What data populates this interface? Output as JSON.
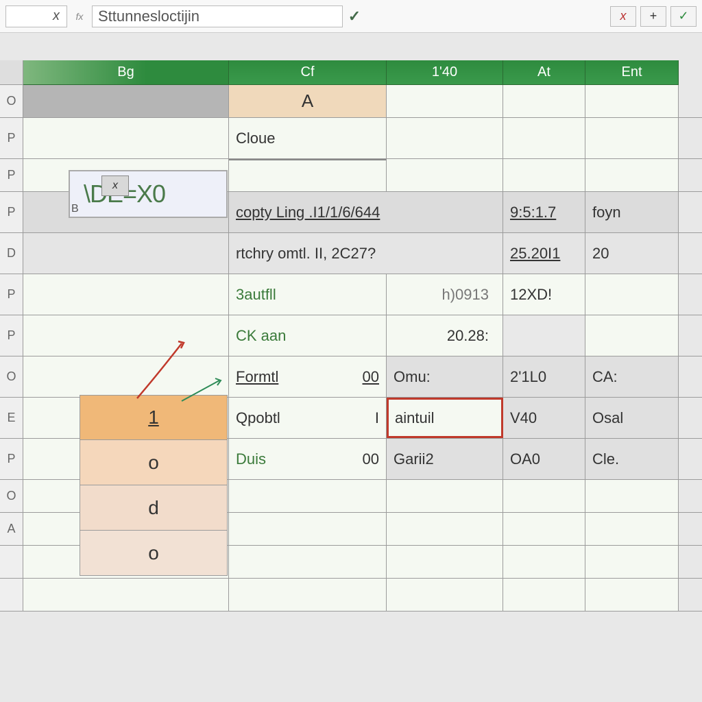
{
  "formula_bar": {
    "name_box": "x",
    "fx_label": "fx",
    "input_text": "Sttunnesloctijin",
    "controls": {
      "check1": "✓",
      "x": "x",
      "plus": "+",
      "check2": "✓"
    }
  },
  "col_headers": {
    "A": "Bg",
    "B": "Cf",
    "C": "1'40",
    "D": "At",
    "E": "Ent"
  },
  "name_badge": {
    "mini": "x",
    "corner": "B",
    "text": "\\DE=X0"
  },
  "orange_block": [
    "1",
    "o",
    "d",
    "o"
  ],
  "row_labels": [
    "O",
    "P",
    "P",
    "D",
    "P",
    "P",
    "O",
    "E",
    "P",
    "O",
    "A",
    "",
    "",
    ""
  ],
  "grid": {
    "r1": {
      "B": "A"
    },
    "r2": {
      "B": "Cloue"
    },
    "r3": {},
    "r4": {
      "B": "copty Ling .I1/1/6/644",
      "D": "9:5:1.7",
      "E": "foyn"
    },
    "r5": {
      "B": "rtchry omtl. II, 2C27?",
      "D": "25.20I1",
      "E": "20"
    },
    "r6": {
      "B": "3autfll",
      "C": "h)0913",
      "D": "12XD!"
    },
    "r7": {
      "B": "CK aan",
      "C": "20.28:"
    },
    "r8": {
      "B": "Formtl",
      "Bnum": "00",
      "C": "Omu:",
      "D": "2'1L0",
      "E": "CA:"
    },
    "r9": {
      "B": "Qpobtl",
      "Bnum": "I",
      "C": "aintuil",
      "D": "V40",
      "E": "Osal"
    },
    "r10": {
      "B": "Duis",
      "Bnum": "00",
      "C": "Garii2",
      "D": "OA0",
      "E": "Cle."
    }
  }
}
